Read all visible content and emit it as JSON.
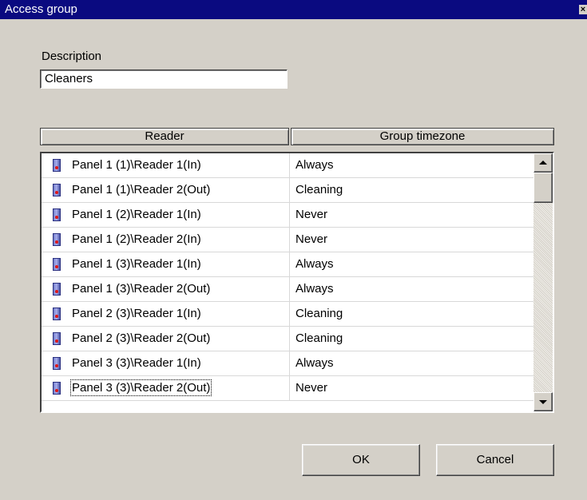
{
  "window": {
    "title": "Access group",
    "close_glyph": "×"
  },
  "description": {
    "label": "Description",
    "value": "Cleaners"
  },
  "table": {
    "headers": {
      "reader": "Reader",
      "timezone": "Group timezone"
    },
    "rows": [
      {
        "reader": "Panel 1 (1)\\Reader 1(In)",
        "timezone": "Always"
      },
      {
        "reader": "Panel 1 (1)\\Reader 2(Out)",
        "timezone": "Cleaning"
      },
      {
        "reader": "Panel 1 (2)\\Reader 1(In)",
        "timezone": "Never"
      },
      {
        "reader": "Panel 1 (2)\\Reader 2(In)",
        "timezone": "Never"
      },
      {
        "reader": "Panel 1 (3)\\Reader 1(In)",
        "timezone": "Always"
      },
      {
        "reader": "Panel 1 (3)\\Reader 2(Out)",
        "timezone": "Always"
      },
      {
        "reader": "Panel 2 (3)\\Reader 1(In)",
        "timezone": "Cleaning"
      },
      {
        "reader": "Panel 2 (3)\\Reader 2(Out)",
        "timezone": "Cleaning"
      },
      {
        "reader": "Panel 3 (3)\\Reader 1(In)",
        "timezone": "Always"
      },
      {
        "reader": "Panel 3 (3)\\Reader 2(Out)",
        "timezone": "Never"
      }
    ],
    "row_icon": "reader-icon"
  },
  "buttons": {
    "ok": "OK",
    "cancel": "Cancel"
  },
  "colors": {
    "titlebar": "#0a0a80",
    "face": "#d4d0c8"
  }
}
